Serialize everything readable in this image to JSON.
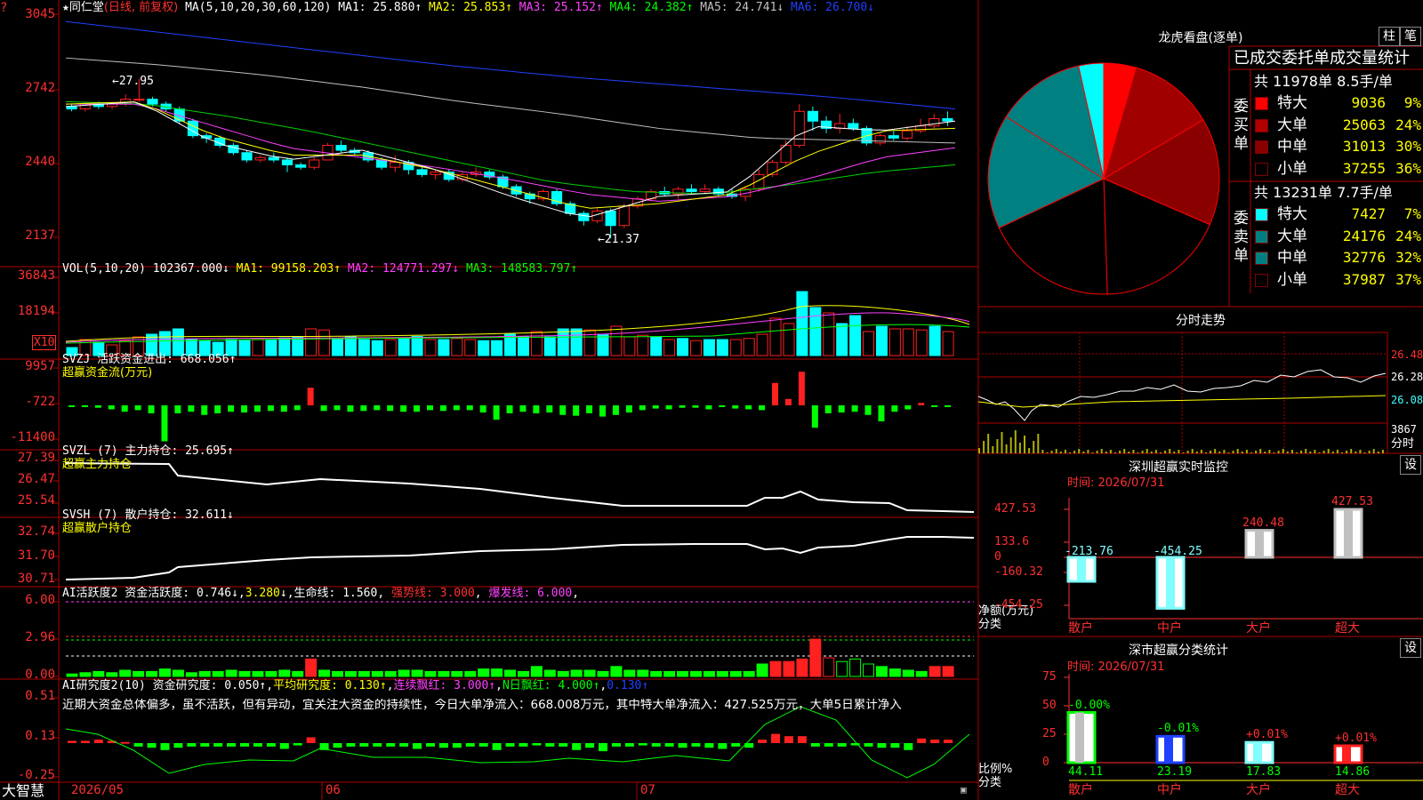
{
  "colors": {
    "up": "#ff2020",
    "down": "#00ffff",
    "bg": "#000000",
    "grid": "#b00000"
  },
  "price_panel": {
    "star": "★",
    "name": "同仁堂",
    "mode": "(日线, 前复权)",
    "ma_label": "MA(5,10,20,30,60,120)",
    "ma1": "MA1: 25.880↑",
    "ma2": "MA2: 25.853↑",
    "ma3": "MA3: 25.152↑",
    "ma4": "MA4: 24.382↑",
    "ma5": "MA5: 24.741↓",
    "ma6": "MA6: 26.700↓",
    "y_ticks": [
      "3045",
      "2742",
      "2440",
      "2137"
    ],
    "high_label": "27.95",
    "low_label": "21.37"
  },
  "vol_panel": {
    "label": "VOL(5,10,20)",
    "value": "102367.000↓",
    "ma1": "MA1: 99158.203↑",
    "ma2": "MA2: 124771.297↓",
    "ma3": "MA3: 148583.797↑",
    "y_ticks": [
      "36843",
      "18194"
    ],
    "unit": "X10"
  },
  "svzj_panel": {
    "label": "SVZJ  活跃资金进出: 668.056↑",
    "sub": "超赢资金流(万元)",
    "y_ticks": [
      "9957",
      "-722",
      "-11400"
    ]
  },
  "svzl_panel": {
    "label": "SVZL (7) 主力持仓: 25.695↑",
    "sub": "超赢主力持仓",
    "y_ticks": [
      "27.39",
      "26.47",
      "25.54"
    ]
  },
  "svsh_panel": {
    "label": "SVSH (7) 散户持仓: 32.611↓",
    "sub": "超赢散户持仓",
    "y_ticks": [
      "32.74",
      "31.70",
      "30.71"
    ]
  },
  "ai_activity_panel": {
    "label": "AI活跃度2 资金活跃度: 0.746↓",
    "v2": "3.280",
    "life": "生命线: 1.560",
    "strong": "强势线: 3.000",
    "burst": "爆发线: 6.000",
    "y_ticks": [
      "6.00",
      "2.96",
      "0.00"
    ]
  },
  "ai_research_panel": {
    "label": "AI研究度2(10) 资金研究度: 0.050↑",
    "avg": "平均研究度: 0.130↑",
    "cont": "连续飘红: 3.000↑",
    "nday": "N日飘红: 4.000↑",
    "last": "0.130↑",
    "comment": "近期大资金总体偏多，虽不活跃，但有异动，宜关注大资金的持续性，今日大单净流入：668.008万元，其中特大单净流入：427.525万元，大单5日累计净入",
    "y_ticks": [
      "0.51",
      "0.13",
      "-0.25"
    ]
  },
  "bottom_bar": {
    "brand": "大智慧",
    "dates": [
      "2026/05",
      "06",
      "07"
    ]
  },
  "dragon_tiger": {
    "title": "龙虎看盘(逐单)",
    "btn1": "柱",
    "btn2": "笔",
    "stats_title": "已成交委托单成交量统计",
    "buy_side_label": "委买单",
    "buy_total": "共 11978单 8.5手/单",
    "buy_rows": [
      {
        "name": "特大",
        "vol": "9036",
        "pct": "9%",
        "color": "#ff0000"
      },
      {
        "name": "大单",
        "vol": "25063",
        "pct": "24%",
        "color": "#b00000"
      },
      {
        "name": "中单",
        "vol": "31013",
        "pct": "30%",
        "color": "#8a0000"
      },
      {
        "name": "小单",
        "vol": "37255",
        "pct": "36%",
        "color": "#000000"
      }
    ],
    "sell_side_label": "委卖单",
    "sell_total": "共 13231单 7.7手/单",
    "sell_rows": [
      {
        "name": "特大",
        "vol": "7427",
        "pct": "7%",
        "color": "#00ffff"
      },
      {
        "name": "大单",
        "vol": "24176",
        "pct": "24%",
        "color": "#008080"
      },
      {
        "name": "中单",
        "vol": "32776",
        "pct": "32%",
        "color": "#008080"
      },
      {
        "name": "小单",
        "vol": "37987",
        "pct": "37%",
        "color": "#000000"
      }
    ]
  },
  "intraday": {
    "title": "分时走势",
    "price_ticks": [
      "26.48",
      "26.28",
      "26.08"
    ],
    "vol_tick": "3867",
    "vol_label": "分时"
  },
  "sz_monitor": {
    "title": "深圳超赢实时监控",
    "btn": "设",
    "time": "时间: 2026/07/31",
    "y_ticks": [
      "427.53",
      "133.6",
      "0",
      "-160.32",
      "-454.25"
    ],
    "y_label": "净额(万元)",
    "x_label": "分类",
    "chart_data": {
      "type": "bar",
      "categories": [
        "散户",
        "中户",
        "大户",
        "超大"
      ],
      "values": [
        -213.76,
        -454.25,
        240.48,
        427.53
      ],
      "labels": [
        "-213.76",
        "-454.25",
        "240.48",
        "427.53"
      ],
      "ylim": [
        -454.25,
        427.53
      ]
    }
  },
  "sz_class": {
    "title": "深市超赢分类统计",
    "btn": "设",
    "time": "时间: 2026/07/31",
    "y_ticks": [
      "75",
      "50",
      "25",
      "0"
    ],
    "y_label": "比例%",
    "x_label": "分类",
    "chart_data": {
      "type": "bar",
      "categories": [
        "散户",
        "中户",
        "大户",
        "超大"
      ],
      "values": [
        44.11,
        23.19,
        17.83,
        14.86
      ],
      "value_labels": [
        "44.11",
        "23.19",
        "17.83",
        "14.86"
      ],
      "change_labels": [
        "-0.00%",
        "-0.01%",
        "+0.01%",
        "+0.01%"
      ],
      "ylim": [
        0,
        75
      ]
    }
  }
}
